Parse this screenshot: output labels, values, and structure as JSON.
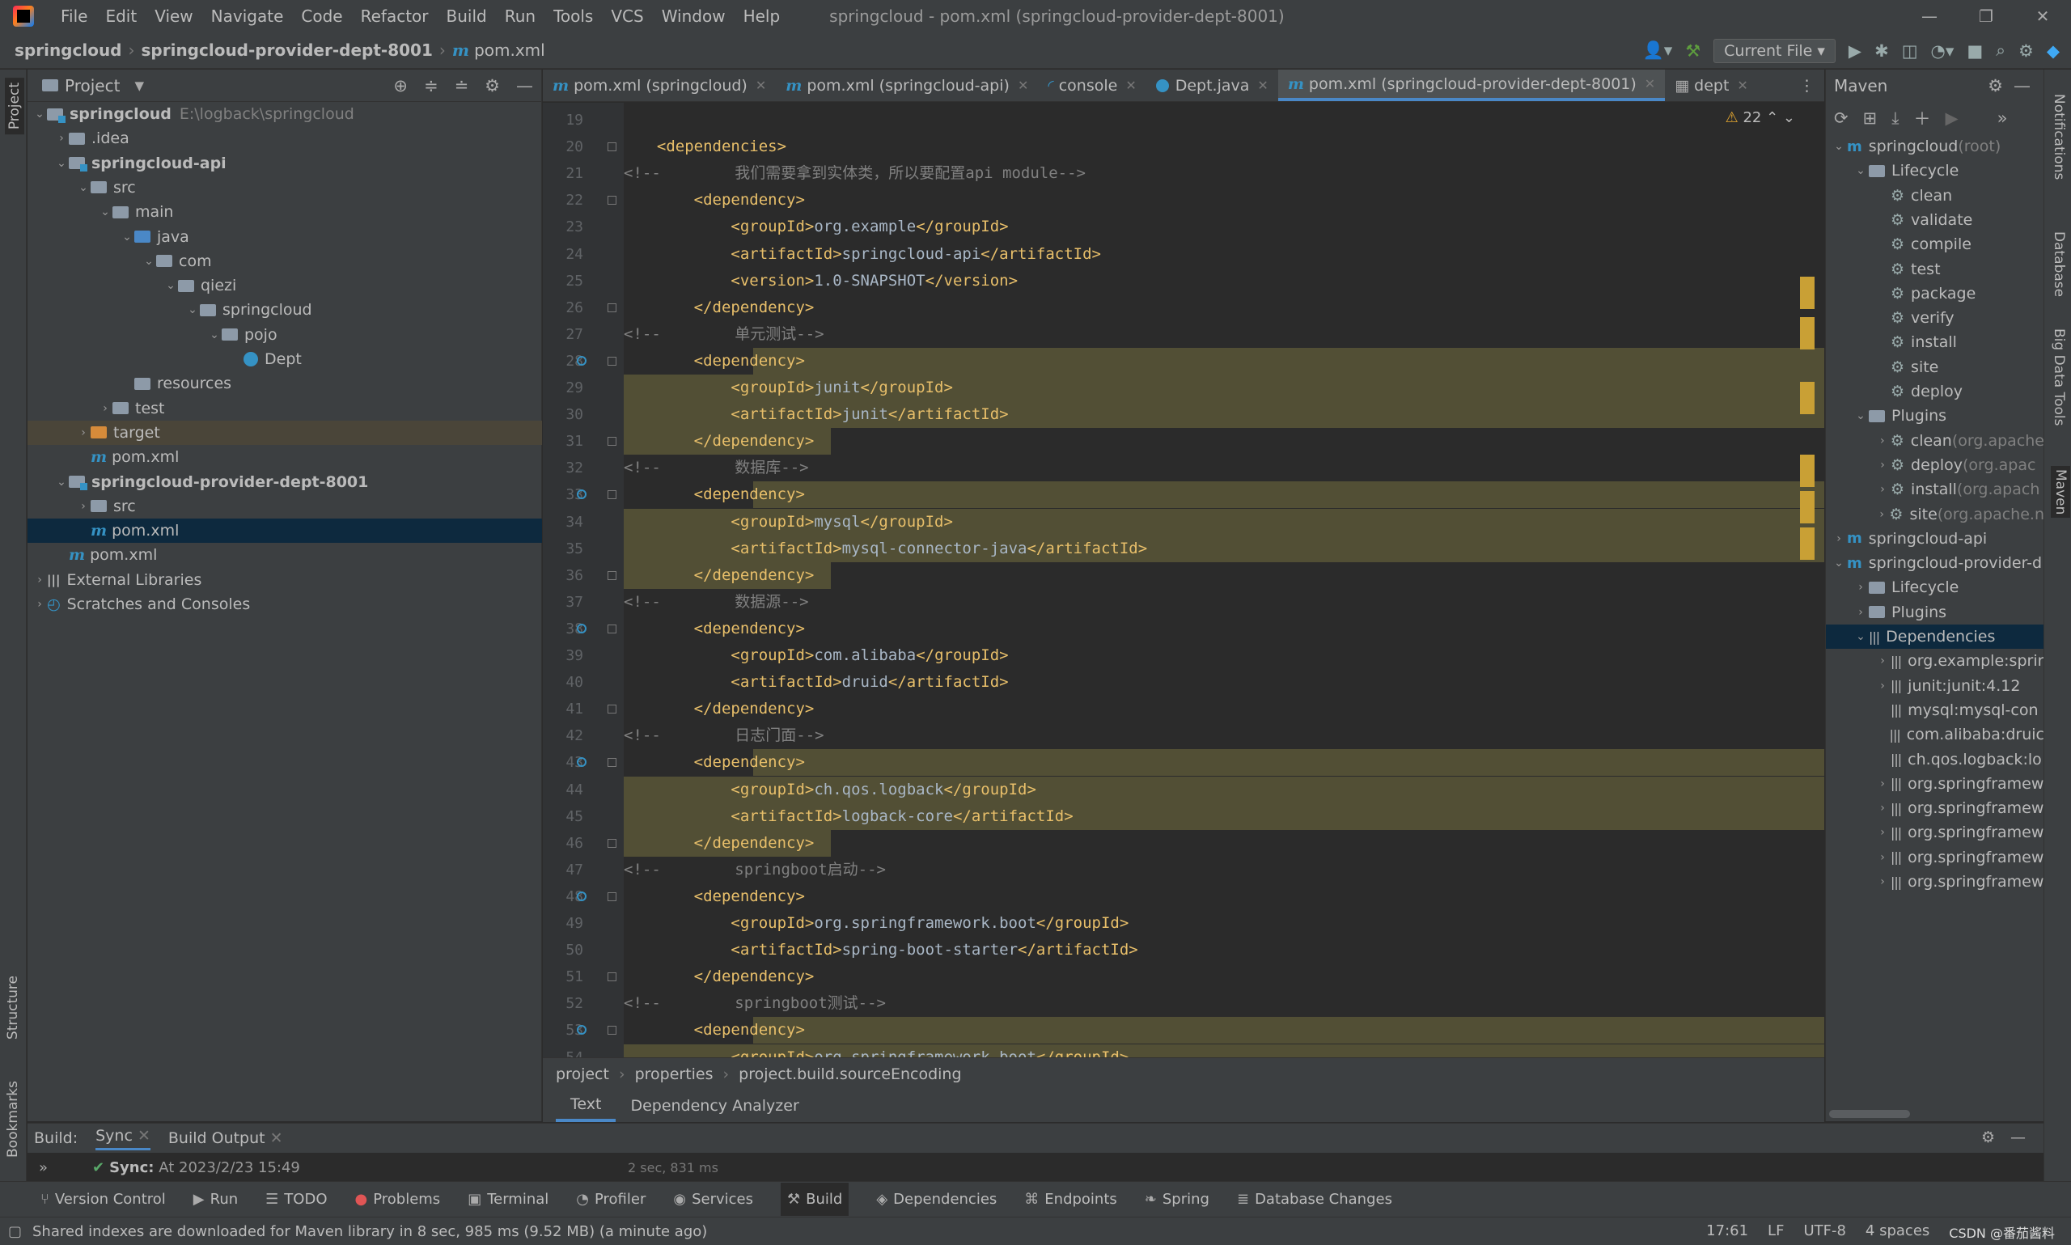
{
  "window": {
    "title": "springcloud - pom.xml (springcloud-provider-dept-8001)",
    "menu": [
      "File",
      "Edit",
      "View",
      "Navigate",
      "Code",
      "Refactor",
      "Build",
      "Run",
      "Tools",
      "VCS",
      "Window",
      "Help"
    ]
  },
  "navbar": {
    "crumbs": [
      "springcloud",
      "springcloud-provider-dept-8001",
      "pom.xml"
    ],
    "run_config": "Current File"
  },
  "left_stripe": [
    "Project",
    "Structure",
    "Bookmarks"
  ],
  "right_stripe": [
    "Notifications",
    "Database",
    "Big Data Tools",
    "Maven"
  ],
  "project": {
    "title": "Project",
    "tree": [
      {
        "label": "springcloud",
        "hint": "E:\\logback\\springcloud",
        "depth": 0,
        "type": "module",
        "expanded": true
      },
      {
        "label": ".idea",
        "depth": 1,
        "type": "folder",
        "expanded": false
      },
      {
        "label": "springcloud-api",
        "depth": 1,
        "type": "module",
        "expanded": true
      },
      {
        "label": "src",
        "depth": 2,
        "type": "folder",
        "expanded": true
      },
      {
        "label": "main",
        "depth": 3,
        "type": "folder",
        "expanded": true
      },
      {
        "label": "java",
        "depth": 4,
        "type": "src",
        "expanded": true
      },
      {
        "label": "com",
        "depth": 5,
        "type": "folder",
        "expanded": true
      },
      {
        "label": "qiezi",
        "depth": 6,
        "type": "folder",
        "expanded": true
      },
      {
        "label": "springcloud",
        "depth": 7,
        "type": "folder",
        "expanded": true
      },
      {
        "label": "pojo",
        "depth": 8,
        "type": "folder",
        "expanded": true
      },
      {
        "label": "Dept",
        "depth": 9,
        "type": "class"
      },
      {
        "label": "resources",
        "depth": 4,
        "type": "res"
      },
      {
        "label": "test",
        "depth": 3,
        "type": "folder",
        "expanded": false
      },
      {
        "label": "target",
        "depth": 2,
        "type": "orange",
        "expanded": false
      },
      {
        "label": "pom.xml",
        "depth": 2,
        "type": "maven"
      },
      {
        "label": "springcloud-provider-dept-8001",
        "depth": 1,
        "type": "module",
        "expanded": true
      },
      {
        "label": "src",
        "depth": 2,
        "type": "folder",
        "expanded": false
      },
      {
        "label": "pom.xml",
        "depth": 2,
        "type": "maven"
      },
      {
        "label": "pom.xml",
        "depth": 1,
        "type": "maven"
      },
      {
        "label": "External Libraries",
        "depth": 0,
        "type": "lib",
        "expanded": false
      },
      {
        "label": "Scratches and Consoles",
        "depth": 0,
        "type": "scratch",
        "expanded": false
      }
    ]
  },
  "tabs": [
    {
      "label": "pom.xml (springcloud)",
      "icon": "maven"
    },
    {
      "label": "pom.xml (springcloud-api)",
      "icon": "maven"
    },
    {
      "label": "console",
      "icon": "console"
    },
    {
      "label": "Dept.java",
      "icon": "class"
    },
    {
      "label": "pom.xml (springcloud-provider-dept-8001)",
      "icon": "maven",
      "active": true
    },
    {
      "label": "dept",
      "icon": "table"
    }
  ],
  "editor": {
    "warning_count": "22",
    "lines": [
      {
        "n": "19",
        "indent": 0,
        "parts": []
      },
      {
        "n": "20",
        "indent": 1,
        "parts": [
          [
            "tag",
            "<dependencies>"
          ]
        ]
      },
      {
        "n": "21",
        "indent": 0,
        "parts": [
          [
            "cmt",
            "<!--        我们需要拿到实体类，所以要配置api module-->"
          ]
        ]
      },
      {
        "n": "22",
        "indent": 2,
        "parts": [
          [
            "tag",
            "<dependency>"
          ]
        ]
      },
      {
        "n": "23",
        "indent": 3,
        "parts": [
          [
            "tag",
            "<groupId>"
          ],
          [
            "val",
            "org.example"
          ],
          [
            "tag",
            "</groupId>"
          ]
        ]
      },
      {
        "n": "24",
        "indent": 3,
        "parts": [
          [
            "tag",
            "<artifactId>"
          ],
          [
            "val",
            "springcloud-api"
          ],
          [
            "tag",
            "</artifactId>"
          ]
        ]
      },
      {
        "n": "25",
        "indent": 3,
        "parts": [
          [
            "tag",
            "<version>"
          ],
          [
            "val",
            "1.0-SNAPSHOT"
          ],
          [
            "tag",
            "</version>"
          ]
        ]
      },
      {
        "n": "26",
        "indent": 2,
        "parts": [
          [
            "tag",
            "</dependency>"
          ]
        ]
      },
      {
        "n": "27",
        "indent": 0,
        "parts": [
          [
            "cmt",
            "<!--        单元测试-->"
          ]
        ]
      },
      {
        "n": "28",
        "indent": 2,
        "parts": [
          [
            "tag",
            "<dependency>"
          ]
        ],
        "hl": true
      },
      {
        "n": "29",
        "indent": 3,
        "parts": [
          [
            "tag",
            "<groupId>"
          ],
          [
            "val",
            "junit"
          ],
          [
            "tag",
            "</groupId>"
          ]
        ],
        "hl": true
      },
      {
        "n": "30",
        "indent": 3,
        "parts": [
          [
            "tag",
            "<artifactId>"
          ],
          [
            "val",
            "junit"
          ],
          [
            "tag",
            "</artifactId>"
          ]
        ],
        "hl": true
      },
      {
        "n": "31",
        "indent": 2,
        "parts": [
          [
            "tag",
            "</dependency>"
          ]
        ],
        "hl": true
      },
      {
        "n": "32",
        "indent": 0,
        "parts": [
          [
            "cmt",
            "<!--        数据库-->"
          ]
        ]
      },
      {
        "n": "33",
        "indent": 2,
        "parts": [
          [
            "tag",
            "<dependency>"
          ]
        ],
        "hl": true
      },
      {
        "n": "34",
        "indent": 3,
        "parts": [
          [
            "tag",
            "<groupId>"
          ],
          [
            "val",
            "mysql"
          ],
          [
            "tag",
            "</groupId>"
          ]
        ],
        "hl": true
      },
      {
        "n": "35",
        "indent": 3,
        "parts": [
          [
            "tag",
            "<artifactId>"
          ],
          [
            "val",
            "mysql-connector-java"
          ],
          [
            "tag",
            "</artifactId>"
          ]
        ],
        "hl": true
      },
      {
        "n": "36",
        "indent": 2,
        "parts": [
          [
            "tag",
            "</dependency>"
          ]
        ],
        "hl": true
      },
      {
        "n": "37",
        "indent": 0,
        "parts": [
          [
            "cmt",
            "<!--        数据源-->"
          ]
        ]
      },
      {
        "n": "38",
        "indent": 2,
        "parts": [
          [
            "tag",
            "<dependency>"
          ]
        ]
      },
      {
        "n": "39",
        "indent": 3,
        "parts": [
          [
            "tag",
            "<groupId>"
          ],
          [
            "val",
            "com.alibaba"
          ],
          [
            "tag",
            "</groupId>"
          ]
        ]
      },
      {
        "n": "40",
        "indent": 3,
        "parts": [
          [
            "tag",
            "<artifactId>"
          ],
          [
            "val",
            "druid"
          ],
          [
            "tag",
            "</artifactId>"
          ]
        ]
      },
      {
        "n": "41",
        "indent": 2,
        "parts": [
          [
            "tag",
            "</dependency>"
          ]
        ]
      },
      {
        "n": "42",
        "indent": 0,
        "parts": [
          [
            "cmt",
            "<!--        日志门面-->"
          ]
        ]
      },
      {
        "n": "43",
        "indent": 2,
        "parts": [
          [
            "tag",
            "<dependency>"
          ]
        ],
        "hl": true
      },
      {
        "n": "44",
        "indent": 3,
        "parts": [
          [
            "tag",
            "<groupId>"
          ],
          [
            "val",
            "ch.qos.logback"
          ],
          [
            "tag",
            "</groupId>"
          ]
        ],
        "hl": true
      },
      {
        "n": "45",
        "indent": 3,
        "parts": [
          [
            "tag",
            "<artifactId>"
          ],
          [
            "val",
            "logback-core"
          ],
          [
            "tag",
            "</artifactId>"
          ]
        ],
        "hl": true
      },
      {
        "n": "46",
        "indent": 2,
        "parts": [
          [
            "tag",
            "</dependency>"
          ]
        ],
        "hl": true
      },
      {
        "n": "47",
        "indent": 0,
        "parts": [
          [
            "cmt",
            "<!--        springboot启动-->"
          ]
        ]
      },
      {
        "n": "48",
        "indent": 2,
        "parts": [
          [
            "tag",
            "<dependency>"
          ]
        ]
      },
      {
        "n": "49",
        "indent": 3,
        "parts": [
          [
            "tag",
            "<groupId>"
          ],
          [
            "val",
            "org.springframework.boot"
          ],
          [
            "tag",
            "</groupId>"
          ]
        ]
      },
      {
        "n": "50",
        "indent": 3,
        "parts": [
          [
            "tag",
            "<artifactId>"
          ],
          [
            "val",
            "spring-boot-starter"
          ],
          [
            "tag",
            "</artifactId>"
          ]
        ]
      },
      {
        "n": "51",
        "indent": 2,
        "parts": [
          [
            "tag",
            "</dependency>"
          ]
        ]
      },
      {
        "n": "52",
        "indent": 0,
        "parts": [
          [
            "cmt",
            "<!--        springboot测试-->"
          ]
        ]
      },
      {
        "n": "53",
        "indent": 2,
        "parts": [
          [
            "tag",
            "<dependency>"
          ]
        ],
        "hl": true
      },
      {
        "n": "54",
        "indent": 3,
        "parts": [
          [
            "tag",
            "<groupId>"
          ],
          [
            "val",
            "org.springframework.boot"
          ],
          [
            "tag",
            "</groupId>"
          ]
        ],
        "hl": true
      }
    ],
    "gutter_marks": [
      "28",
      "33",
      "38",
      "43",
      "48",
      "53"
    ]
  },
  "breadcrumb": [
    "project",
    "properties",
    "project.build.sourceEncoding"
  ],
  "editor_bottom_tabs": [
    "Text",
    "Dependency Analyzer"
  ],
  "maven": {
    "title": "Maven",
    "tree": [
      {
        "label": "springcloud",
        "hint": "(root)",
        "depth": 0,
        "type": "mvn",
        "arrow": "open"
      },
      {
        "label": "Lifecycle",
        "depth": 1,
        "type": "folder",
        "arrow": "open"
      },
      {
        "label": "clean",
        "depth": 2,
        "type": "gear"
      },
      {
        "label": "validate",
        "depth": 2,
        "type": "gear"
      },
      {
        "label": "compile",
        "depth": 2,
        "type": "gear"
      },
      {
        "label": "test",
        "depth": 2,
        "type": "gear"
      },
      {
        "label": "package",
        "depth": 2,
        "type": "gear"
      },
      {
        "label": "verify",
        "depth": 2,
        "type": "gear"
      },
      {
        "label": "install",
        "depth": 2,
        "type": "gear"
      },
      {
        "label": "site",
        "depth": 2,
        "type": "gear"
      },
      {
        "label": "deploy",
        "depth": 2,
        "type": "gear"
      },
      {
        "label": "Plugins",
        "depth": 1,
        "type": "folder",
        "arrow": "open"
      },
      {
        "label": "clean",
        "hint": "(org.apache",
        "depth": 2,
        "type": "plugin",
        "arrow": "closed"
      },
      {
        "label": "deploy",
        "hint": "(org.apac",
        "depth": 2,
        "type": "plugin",
        "arrow": "closed"
      },
      {
        "label": "install",
        "hint": "(org.apach",
        "depth": 2,
        "type": "plugin",
        "arrow": "closed"
      },
      {
        "label": "site",
        "hint": "(org.apache.n",
        "depth": 2,
        "type": "plugin",
        "arrow": "closed"
      },
      {
        "label": "springcloud-api",
        "depth": 0,
        "type": "mvn",
        "arrow": "closed"
      },
      {
        "label": "springcloud-provider-d",
        "depth": 0,
        "type": "mvn",
        "arrow": "open"
      },
      {
        "label": "Lifecycle",
        "depth": 1,
        "type": "folder",
        "arrow": "closed"
      },
      {
        "label": "Plugins",
        "depth": 1,
        "type": "folder",
        "arrow": "closed"
      },
      {
        "label": "Dependencies",
        "depth": 1,
        "type": "dep",
        "arrow": "open",
        "selected": true
      },
      {
        "label": "org.example:sprir",
        "depth": 2,
        "type": "dep",
        "arrow": "closed"
      },
      {
        "label": "junit:junit:4.12",
        "depth": 2,
        "type": "dep",
        "arrow": "closed"
      },
      {
        "label": "mysql:mysql-con",
        "depth": 2,
        "type": "dep"
      },
      {
        "label": "com.alibaba:druic",
        "depth": 2,
        "type": "dep"
      },
      {
        "label": "ch.qos.logback:lo",
        "depth": 2,
        "type": "dep"
      },
      {
        "label": "org.springframew",
        "depth": 2,
        "type": "dep",
        "arrow": "closed"
      },
      {
        "label": "org.springframew",
        "depth": 2,
        "type": "dep",
        "arrow": "closed"
      },
      {
        "label": "org.springframew",
        "depth": 2,
        "type": "dep",
        "arrow": "closed"
      },
      {
        "label": "org.springframew",
        "depth": 2,
        "type": "dep",
        "arrow": "closed"
      },
      {
        "label": "org.springframew",
        "depth": 2,
        "type": "dep",
        "arrow": "closed"
      }
    ]
  },
  "build": {
    "label": "Build:",
    "tabs": [
      "Sync",
      "Build Output"
    ],
    "sync_label": "Sync:",
    "sync_time": "At 2023/2/23 15:49",
    "duration": "2 sec, 831 ms"
  },
  "tool_windows": [
    {
      "label": "Version Control",
      "icon": "⑂"
    },
    {
      "label": "Run",
      "icon": "▶"
    },
    {
      "label": "TODO",
      "icon": "☰"
    },
    {
      "label": "Problems",
      "icon": "●"
    },
    {
      "label": "Terminal",
      "icon": "▣"
    },
    {
      "label": "Profiler",
      "icon": "◔"
    },
    {
      "label": "Services",
      "icon": "◉"
    },
    {
      "label": "Build",
      "icon": "⚒",
      "active": true
    },
    {
      "label": "Dependencies",
      "icon": "◈"
    },
    {
      "label": "Endpoints",
      "icon": "⌘"
    },
    {
      "label": "Spring",
      "icon": "❧"
    },
    {
      "label": "Database Changes",
      "icon": "≣"
    }
  ],
  "status": {
    "message": "Shared indexes are downloaded for Maven library in 8 sec, 985 ms (9.52 MB) (a minute ago)",
    "position": "17:61",
    "line_sep": "LF",
    "encoding": "UTF-8",
    "indent": "4 spaces",
    "watermark": "CSDN @番茄酱料"
  }
}
